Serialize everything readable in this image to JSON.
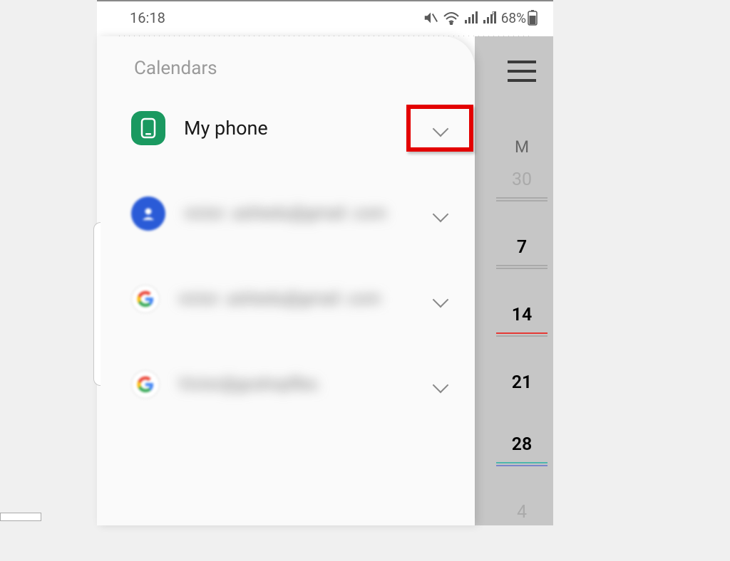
{
  "status": {
    "time": "16:18",
    "battery_pct": "68%"
  },
  "calendar_column": {
    "header": "M",
    "days": [
      {
        "num": "30",
        "muted": true,
        "underline": "grey"
      },
      {
        "num": "7",
        "muted": false,
        "underline": "grey",
        "sel": true
      },
      {
        "num": "14",
        "muted": false,
        "underline": "red",
        "sel": true
      },
      {
        "num": "21",
        "muted": false,
        "underline": "",
        "sel": true
      },
      {
        "num": "28",
        "muted": false,
        "underline": "teal",
        "sel": true
      },
      {
        "num": "4",
        "muted": true,
        "underline": ""
      }
    ]
  },
  "panel": {
    "title": "Calendars",
    "accounts": [
      {
        "icon": "phone",
        "label": "My phone",
        "blurred": false
      },
      {
        "icon": "contacts",
        "label": "victor .ashiedu@gmail .com",
        "blurred": true
      },
      {
        "icon": "google",
        "label": "victor .ashiedu@gmail .com",
        "blurred": true
      },
      {
        "icon": "google",
        "label": "Victor@goshopflex.",
        "blurred": true
      }
    ]
  },
  "highlight": {
    "target": "my-phone-chevron"
  }
}
